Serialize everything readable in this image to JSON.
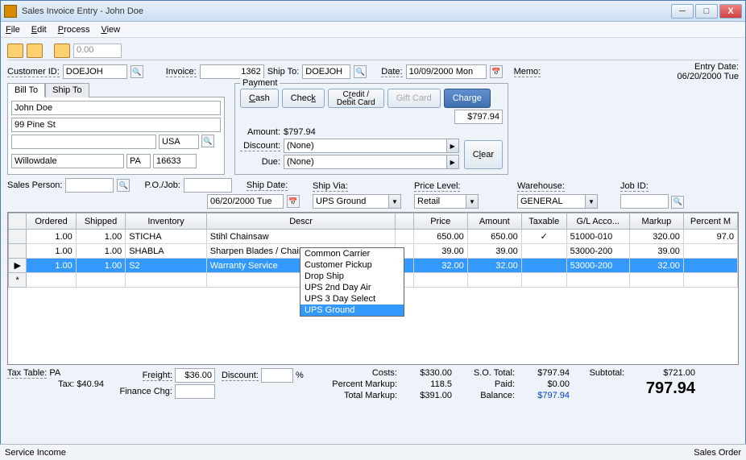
{
  "window": {
    "title": "Sales Invoice Entry - John Doe"
  },
  "menu": {
    "file": "File",
    "edit": "Edit",
    "process": "Process",
    "view": "View"
  },
  "toolbar": {
    "value": "0.00"
  },
  "header": {
    "customer_id_lbl": "Customer ID:",
    "customer_id": "DOEJOH",
    "invoice_lbl": "Invoice:",
    "invoice": "1362",
    "shipto_lbl": "Ship To:",
    "shipto": "DOEJOH",
    "date_lbl": "Date:",
    "date": "10/09/2000 Mon",
    "memo_lbl": "Memo:",
    "entry_date_lbl": "Entry Date:",
    "entry_date": "06/20/2000 Tue"
  },
  "tabs": {
    "billto": "Bill To",
    "shipto": "Ship To"
  },
  "billto": {
    "name": "John Doe",
    "street": "99 Pine St",
    "country": "USA",
    "city": "Willowdale",
    "state": "PA",
    "zip": "16633"
  },
  "payment": {
    "legend": "Payment",
    "cash": "Cash",
    "check": "Check",
    "credit": "Credit / Debit Card",
    "giftcard": "Gift Card",
    "charge": "Charge",
    "charge_amt": "$797.94",
    "amount_lbl": "Amount:",
    "amount": "$797.94",
    "discount_lbl": "Discount:",
    "discount": "(None)",
    "due_lbl": "Due:",
    "due": "(None)",
    "clear": "Clear"
  },
  "mid": {
    "salesperson_lbl": "Sales Person:",
    "pojob_lbl": "P.O./Job:",
    "shipdate_lbl": "Ship Date:",
    "shipdate": "06/20/2000 Tue",
    "shipvia_lbl": "Ship Via:",
    "shipvia": "UPS Ground",
    "pricelevel_lbl": "Price Level:",
    "pricelevel": "Retail",
    "warehouse_lbl": "Warehouse:",
    "warehouse": "GENERAL",
    "jobid_lbl": "Job ID:"
  },
  "shipvia_options": [
    "Common Carrier",
    "Customer Pickup",
    "Drop Ship",
    "UPS 2nd Day Air",
    "UPS 3 Day Select",
    "UPS Ground"
  ],
  "grid": {
    "cols": [
      "Ordered",
      "Shipped",
      "Inventory",
      "Descr",
      "",
      "Price",
      "Amount",
      "Taxable",
      "G/L Acco...",
      "Markup",
      "Percent M"
    ],
    "rows": [
      {
        "ordered": "1.00",
        "shipped": "1.00",
        "inv": "STICHA",
        "desc": "Stihl Chainsaw",
        "price": "650.00",
        "amount": "650.00",
        "tax": "✓",
        "gl": "51000-010",
        "markup": "320.00",
        "pct": "97.0"
      },
      {
        "ordered": "1.00",
        "shipped": "1.00",
        "inv": "SHABLA",
        "desc": "Sharpen Blades /  Chains",
        "price": "39.00",
        "amount": "39.00",
        "tax": "",
        "gl": "53000-200",
        "markup": "39.00",
        "pct": ""
      },
      {
        "ordered": "1.00",
        "shipped": "1.00",
        "inv": "S2",
        "desc": "Warranty Service",
        "price": "32.00",
        "amount": "32.00",
        "tax": "",
        "gl": "53000-200",
        "markup": "32.00",
        "pct": ""
      }
    ]
  },
  "totals": {
    "taxtable_lbl": "Tax Table:",
    "taxtable": "PA",
    "tax_lbl": "Tax:",
    "tax": "$40.94",
    "freight_lbl": "Freight:",
    "freight": "$36.00",
    "finance_lbl": "Finance Chg:",
    "discount_lbl": "Discount:",
    "discount_pct": "%",
    "costs_lbl": "Costs:",
    "costs": "$330.00",
    "pm_lbl": "Percent Markup:",
    "pm": "118.5",
    "tm_lbl": "Total Markup:",
    "tm": "$391.00",
    "sototal_lbl": "S.O. Total:",
    "sototal": "$797.94",
    "paid_lbl": "Paid:",
    "paid": "$0.00",
    "balance_lbl": "Balance:",
    "balance": "$797.94",
    "subtotal_lbl": "Subtotal:",
    "subtotal": "$721.00",
    "grand": "797.94"
  },
  "status": {
    "left": "Service Income",
    "right": "Sales Order"
  }
}
